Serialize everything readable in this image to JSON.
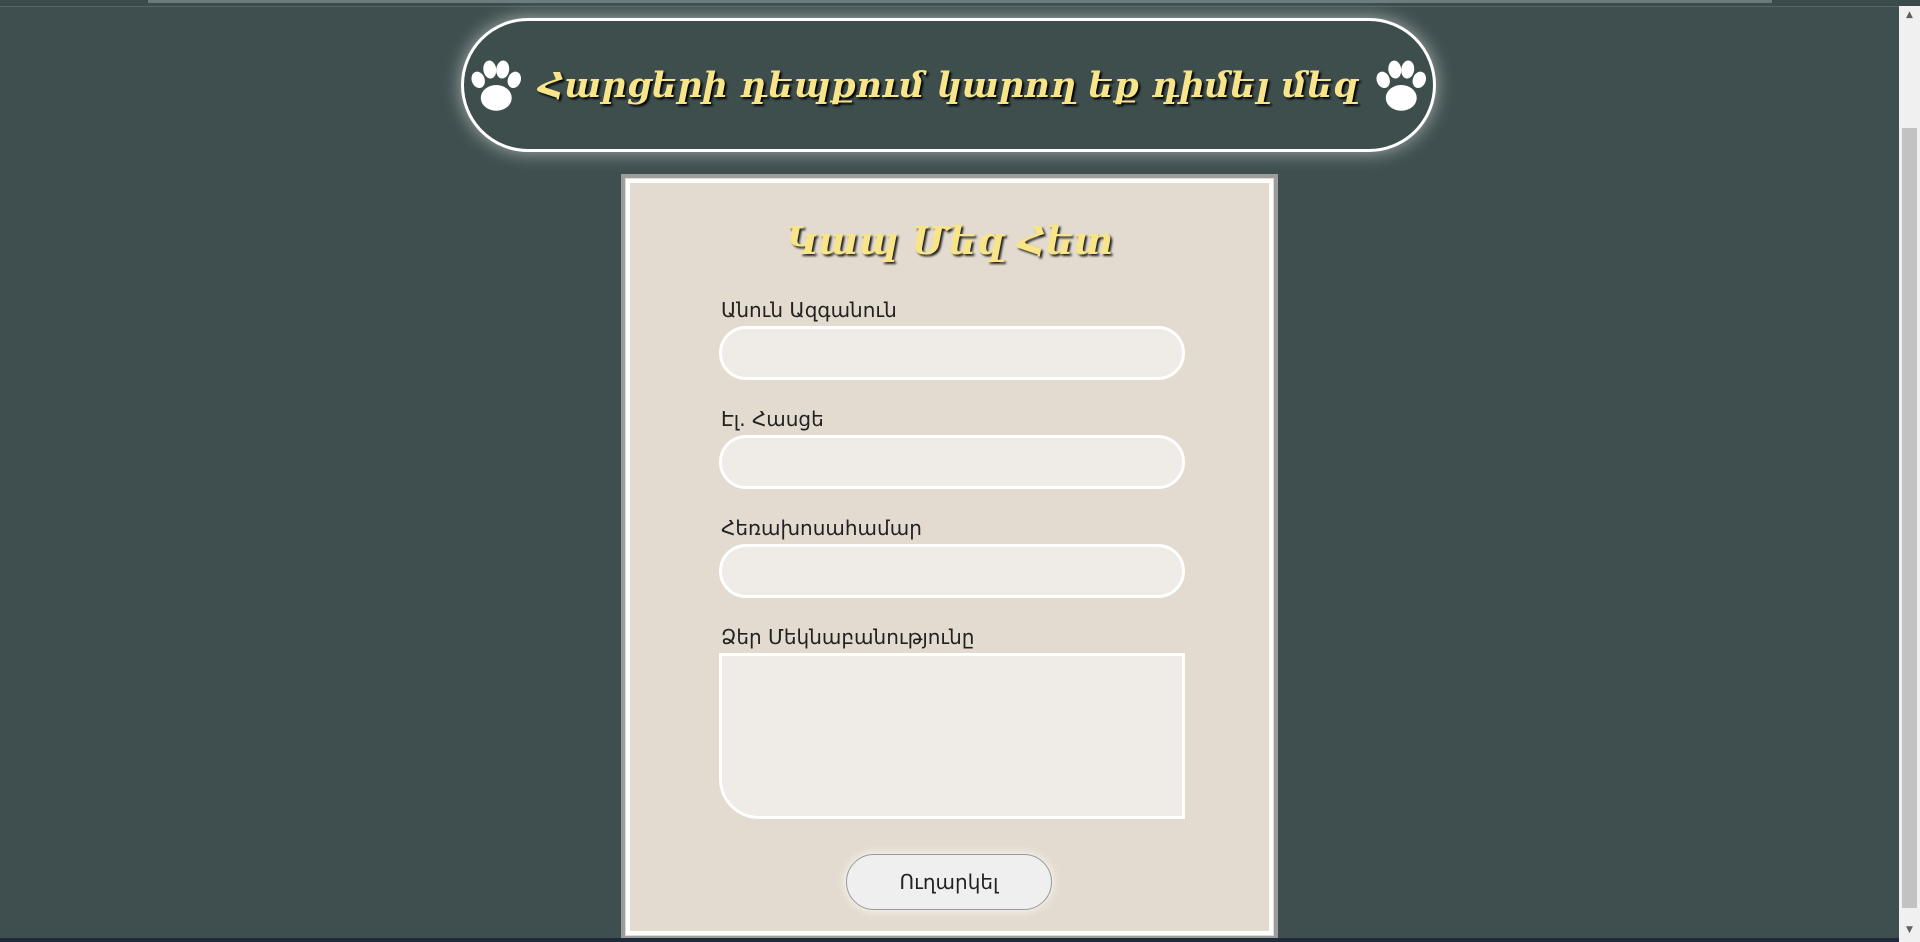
{
  "banner": {
    "text": "Հարցերի դեպքում կարող եք դիմել մեզ",
    "left_icon": "paw-icon",
    "right_icon": "paw-icon"
  },
  "form": {
    "title": "Կապ Մեզ Հետ",
    "fields": [
      {
        "label": "Անուն Ազգանուն",
        "value": "",
        "placeholder": ""
      },
      {
        "label": "Էլ. Հասցե",
        "value": "",
        "placeholder": ""
      },
      {
        "label": "Հեռախոսահամար",
        "value": "",
        "placeholder": ""
      },
      {
        "label": "Ձեր Մեկնաբանությունը",
        "value": "",
        "placeholder": ""
      }
    ],
    "submit_label": "Ուղարկել"
  },
  "scrollbar": {
    "up_icon": "scroll-up-arrow-icon",
    "down_icon": "scroll-down-arrow-icon"
  },
  "colors": {
    "page_background": "#3f4f4f",
    "title_text": "#f8e58a",
    "form_background": "#e3dbcf",
    "input_background": "#efebe6",
    "border": "#ffffff"
  }
}
